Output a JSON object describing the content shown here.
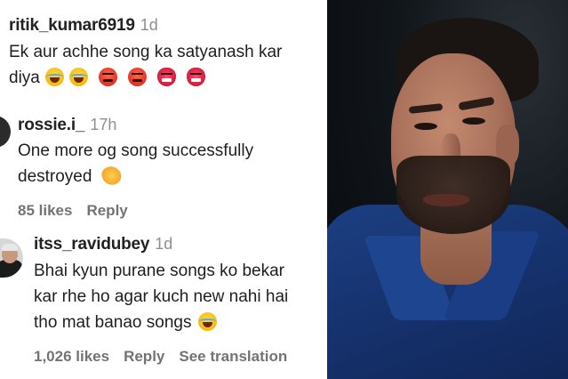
{
  "comments": [
    {
      "username": "ritik_kumar6919",
      "time": "1d",
      "line1": "Ek aur achhe song ka satyanash kar",
      "line2": "diya",
      "emojis": [
        "face-with-tears-of-joy",
        "face-with-tears-of-joy",
        "enraged-face",
        "enraged-face",
        "ogre",
        "ogre"
      ]
    },
    {
      "username": "rossie.i_",
      "time": "17h",
      "line1": "One more og song successfully",
      "line2": "destroyed",
      "emojis": [
        "clapping-hands"
      ],
      "likes": "85 likes",
      "reply": "Reply"
    },
    {
      "username": "itss_ravidubey",
      "time": "1d",
      "line1": "Bhai kyun purane songs ko bekar",
      "line2": "kar rhe ho agar kuch new nahi hai",
      "line3": "tho mat banao songs",
      "emojis": [
        "face-with-tears-of-joy"
      ],
      "likes": "1,026 likes",
      "reply": "Reply",
      "translate": "See translation"
    }
  ],
  "colors": {
    "username": "#222222",
    "meta": "#737373",
    "shirt": "#1c3f82"
  }
}
